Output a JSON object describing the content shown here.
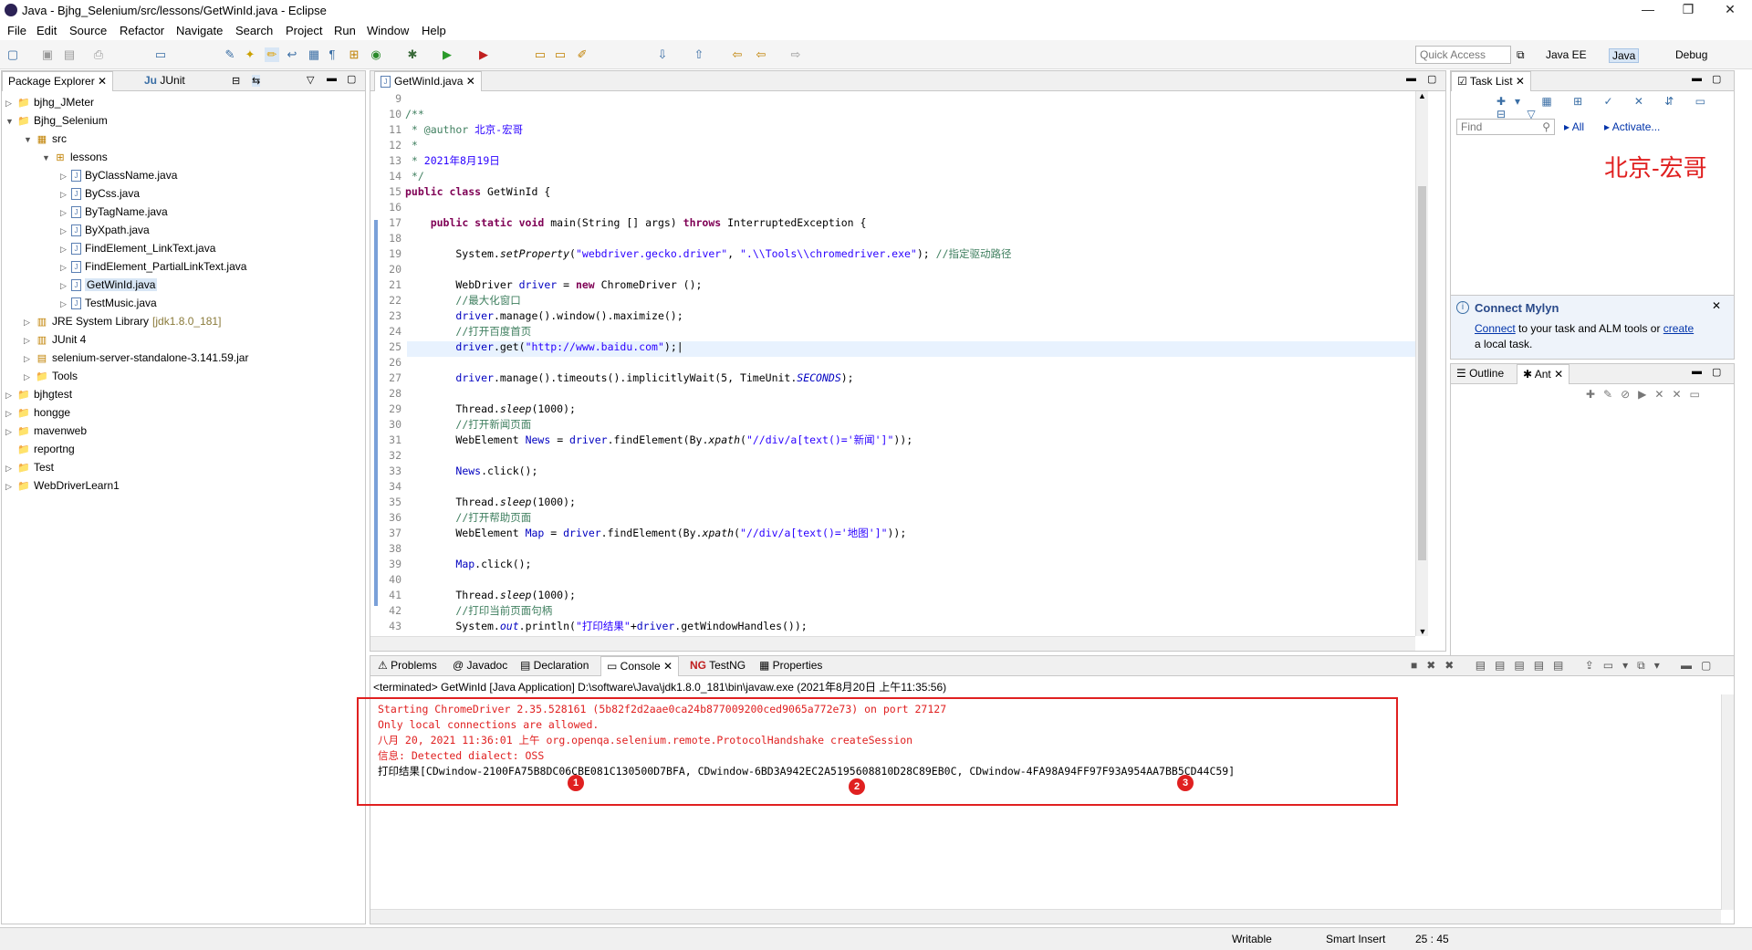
{
  "window": {
    "title": "Java - Bjhg_Selenium/src/lessons/GetWinId.java - Eclipse",
    "buttons": [
      "—",
      "❐",
      "✕"
    ]
  },
  "menu": [
    "File",
    "Edit",
    "Source",
    "Refactor",
    "Navigate",
    "Search",
    "Project",
    "Run",
    "Window",
    "Help"
  ],
  "toolbar": {
    "quick_access": "Quick Access",
    "perspectives": [
      "Java EE",
      "Java",
      "Debug"
    ]
  },
  "package_explorer": {
    "tabs": [
      "Package Explorer",
      "JUnit"
    ],
    "tree": [
      {
        "label": "bjhg_JMeter",
        "depth": 0,
        "icon": "project",
        "expanded": false
      },
      {
        "label": "Bjhg_Selenium",
        "depth": 0,
        "icon": "project",
        "expanded": true
      },
      {
        "label": "src",
        "depth": 1,
        "icon": "src-folder",
        "expanded": true
      },
      {
        "label": "lessons",
        "depth": 2,
        "icon": "package",
        "expanded": true
      },
      {
        "label": "ByClassName.java",
        "depth": 3,
        "icon": "java-file",
        "expanded": false
      },
      {
        "label": "ByCss.java",
        "depth": 3,
        "icon": "java-file",
        "expanded": false
      },
      {
        "label": "ByTagName.java",
        "depth": 3,
        "icon": "java-file",
        "expanded": false
      },
      {
        "label": "ByXpath.java",
        "depth": 3,
        "icon": "java-file",
        "expanded": false
      },
      {
        "label": "FindElement_LinkText.java",
        "depth": 3,
        "icon": "java-file",
        "expanded": false
      },
      {
        "label": "FindElement_PartialLinkText.java",
        "depth": 3,
        "icon": "java-file",
        "expanded": false
      },
      {
        "label": "GetWinId.java",
        "depth": 3,
        "icon": "java-file",
        "expanded": false,
        "selected": true
      },
      {
        "label": "TestMusic.java",
        "depth": 3,
        "icon": "java-file",
        "expanded": false
      },
      {
        "label": "JRE System Library",
        "suffix": "[jdk1.8.0_181]",
        "depth": 1,
        "icon": "library",
        "expanded": false
      },
      {
        "label": "JUnit 4",
        "depth": 1,
        "icon": "library",
        "expanded": false
      },
      {
        "label": "selenium-server-standalone-3.141.59.jar",
        "depth": 1,
        "icon": "jar",
        "expanded": false
      },
      {
        "label": "Tools",
        "depth": 1,
        "icon": "folder",
        "expanded": false
      },
      {
        "label": "bjhgtest",
        "depth": 0,
        "icon": "project",
        "expanded": false
      },
      {
        "label": "hongge",
        "depth": 0,
        "icon": "project",
        "expanded": false
      },
      {
        "label": "mavenweb",
        "depth": 0,
        "icon": "project",
        "expanded": false
      },
      {
        "label": "reportng",
        "depth": 0,
        "icon": "folder",
        "expanded": null
      },
      {
        "label": "Test",
        "depth": 0,
        "icon": "project",
        "expanded": false
      },
      {
        "label": "WebDriverLearn1",
        "depth": 0,
        "icon": "project",
        "expanded": false
      }
    ]
  },
  "editor": {
    "tab": "GetWinId.java",
    "lines": [
      {
        "n": "9",
        "html": ""
      },
      {
        "n": "10",
        "html": "<span class='cm'>/**</span>"
      },
      {
        "n": "11",
        "html": "<span class='cm'> * @author </span><span class='str'>北京-宏哥</span>"
      },
      {
        "n": "12",
        "html": "<span class='cm'> *</span>"
      },
      {
        "n": "13",
        "html": "<span class='cm'> * </span><span class='str'>2021年8月19日</span>"
      },
      {
        "n": "14",
        "html": "<span class='cm'> */</span>"
      },
      {
        "n": "15",
        "html": "<span class='kw'>public class</span> GetWinId {"
      },
      {
        "n": "16",
        "html": ""
      },
      {
        "n": "17",
        "html": "    <span class='kw'>public static void</span> main(String [] args) <span class='kw'>throws</span> InterruptedException {"
      },
      {
        "n": "18",
        "html": ""
      },
      {
        "n": "19",
        "html": "        System.<span class='ital'>setProperty</span>(<span class='str'>\"webdriver.gecko.driver\"</span>, <span class='str'>\".\\\\Tools\\\\chromedriver.exe\"</span>); <span class='cm'>//指定驱动路径</span>"
      },
      {
        "n": "20",
        "html": ""
      },
      {
        "n": "21",
        "html": "        WebDriver <span class='fld'>driver</span> = <span class='kw'>new</span> ChromeDriver ();"
      },
      {
        "n": "22",
        "html": "        <span class='cm'>//最大化窗口</span>"
      },
      {
        "n": "23",
        "html": "        <span class='fld'>driver</span>.manage().window().maximize();"
      },
      {
        "n": "24",
        "html": "        <span class='cm'>//打开百度首页</span>"
      },
      {
        "n": "25",
        "html": "        <span class='fld'>driver</span>.get(<span class='str'>\"http://www.baidu.com\"</span>);|"
      },
      {
        "n": "26",
        "html": ""
      },
      {
        "n": "27",
        "html": "        <span class='fld'>driver</span>.manage().timeouts().implicitlyWait(5, TimeUnit.<span class='fld ital'>SECONDS</span>);"
      },
      {
        "n": "28",
        "html": ""
      },
      {
        "n": "29",
        "html": "        Thread.<span class='ital'>sleep</span>(1000);"
      },
      {
        "n": "30",
        "html": "        <span class='cm'>//打开新闻页面</span>"
      },
      {
        "n": "31",
        "html": "        WebElement <span class='fld'>News</span> = <span class='fld'>driver</span>.findElement(By.<span class='ital'>xpath</span>(<span class='str'>\"//div/a[text()='新闻']\"</span>));"
      },
      {
        "n": "32",
        "html": ""
      },
      {
        "n": "33",
        "html": "        <span class='fld'>News</span>.click();"
      },
      {
        "n": "34",
        "html": ""
      },
      {
        "n": "35",
        "html": "        Thread.<span class='ital'>sleep</span>(1000);"
      },
      {
        "n": "36",
        "html": "        <span class='cm'>//打开帮助页面</span>"
      },
      {
        "n": "37",
        "html": "        WebElement <span class='fld'>Map</span> = <span class='fld'>driver</span>.findElement(By.<span class='ital'>xpath</span>(<span class='str'>\"//div/a[text()='地图']\"</span>));"
      },
      {
        "n": "38",
        "html": ""
      },
      {
        "n": "39",
        "html": "        <span class='fld'>Map</span>.click();"
      },
      {
        "n": "40",
        "html": ""
      },
      {
        "n": "41",
        "html": "        Thread.<span class='ital'>sleep</span>(1000);"
      },
      {
        "n": "42",
        "html": "        <span class='cm'>//打印当前页面句柄</span>"
      },
      {
        "n": "43",
        "html": "        System.<span class='fld ital'>out</span>.println(<span class='str'>\"打印结果\"</span>+<span class='fld'>driver</span>.getWindowHandles());"
      }
    ]
  },
  "task_list": {
    "tab": "Task List",
    "find_placeholder": "Find",
    "all": "All",
    "activate": "Activate...",
    "watermark": "北京-宏哥"
  },
  "mylyn": {
    "title": "Connect Mylyn",
    "connect": "Connect",
    "text1": " to your task and ALM tools or ",
    "create": "create",
    "text2": "a local task."
  },
  "outline": {
    "tabs": [
      "Outline",
      "Ant"
    ]
  },
  "bottom": {
    "tabs": [
      "Problems",
      "Javadoc",
      "Declaration",
      "Console",
      "TestNG",
      "Properties"
    ],
    "terminated": "<terminated> GetWinId [Java Application] D:\\software\\Java\\jdk1.8.0_181\\bin\\javaw.exe (2021年8月20日 上午11:35:56)",
    "console": [
      {
        "text": "Starting ChromeDriver 2.35.528161 (5b82f2d2aae0ca24b877009200ced9065a772e73) on port 27127",
        "red": true
      },
      {
        "text": "Only local connections are allowed.",
        "red": true
      },
      {
        "text": "八月 20, 2021 11:36:01 上午 org.openqa.selenium.remote.ProtocolHandshake createSession",
        "red": true
      },
      {
        "text": "信息: Detected dialect: OSS",
        "red": true
      },
      {
        "text": "打印结果[CDwindow-2100FA75B8DC06CBE081C130500D7BFA, CDwindow-6BD3A942EC2A5195608810D28C89EB0C, CDwindow-4FA98A94FF97F93A954AA7BB5CD44C59]",
        "red": false
      }
    ],
    "markers": [
      "1",
      "2",
      "3"
    ]
  },
  "status": {
    "writable": "Writable",
    "insert": "Smart Insert",
    "position": "25 : 45"
  }
}
